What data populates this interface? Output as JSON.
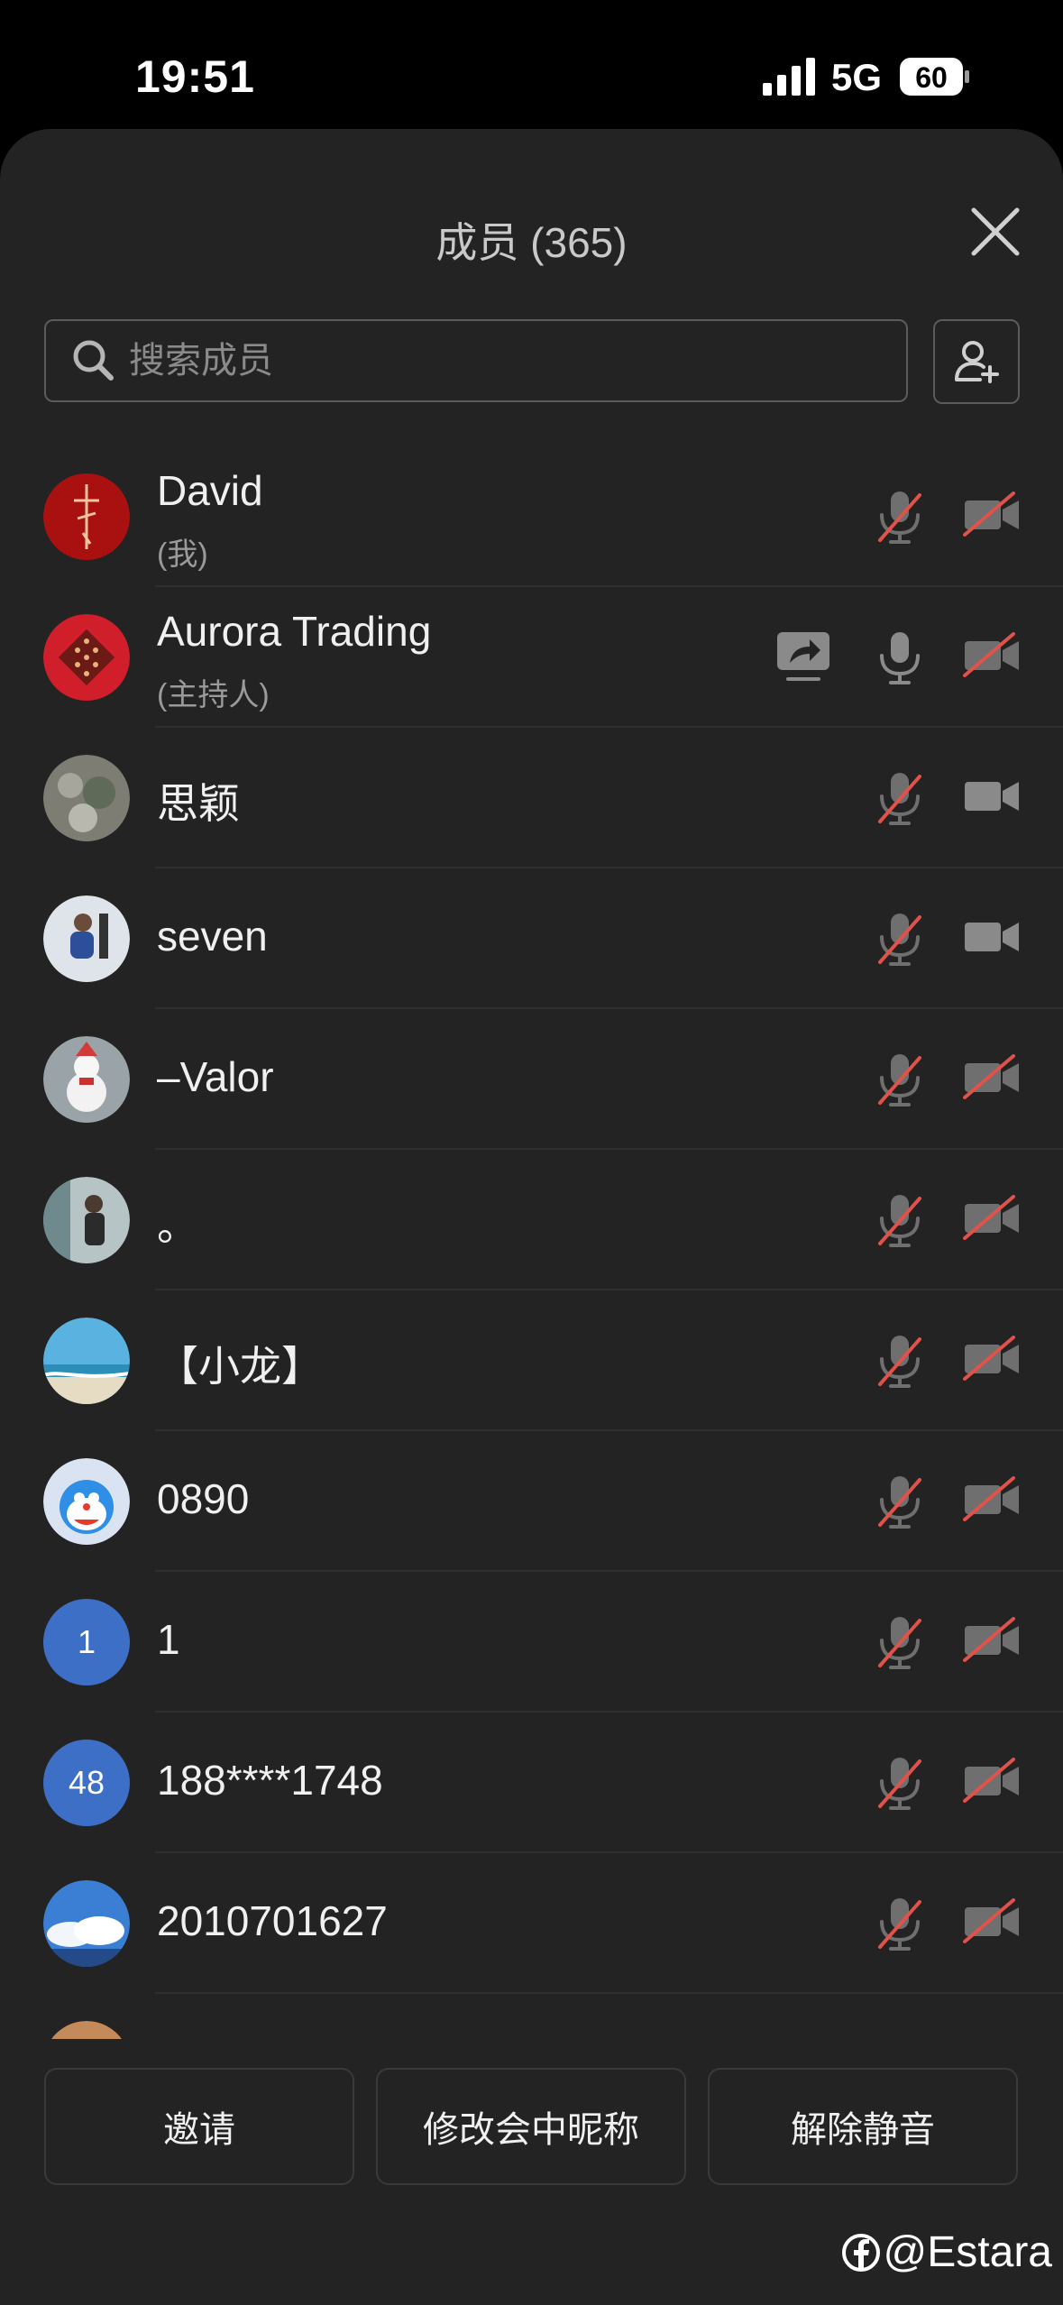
{
  "status_bar": {
    "time": "19:51",
    "network": "5G",
    "battery": "60"
  },
  "sheet": {
    "title": "成员 (365)"
  },
  "search": {
    "placeholder": "搜索成员"
  },
  "members": [
    {
      "name": "David",
      "role": "(我)",
      "mic": "muted",
      "camera": "off",
      "sharing": false
    },
    {
      "name": "Aurora Trading",
      "role": "(主持人)",
      "mic": "on",
      "camera": "off",
      "sharing": true
    },
    {
      "name": "思颖",
      "role": "",
      "mic": "muted",
      "camera": "on",
      "sharing": false
    },
    {
      "name": "seven",
      "role": "",
      "mic": "muted",
      "camera": "on",
      "sharing": false
    },
    {
      "name": "–Valor",
      "role": "",
      "mic": "muted",
      "camera": "off",
      "sharing": false
    },
    {
      "name": "。",
      "role": "",
      "mic": "muted",
      "camera": "off",
      "sharing": false
    },
    {
      "name": "【小龙】",
      "role": "",
      "mic": "muted",
      "camera": "off",
      "sharing": false
    },
    {
      "name": "0890",
      "role": "",
      "mic": "muted",
      "camera": "off",
      "sharing": false
    },
    {
      "name": "1",
      "role": "",
      "avatar_text": "1",
      "mic": "muted",
      "camera": "off",
      "sharing": false
    },
    {
      "name": "188****1748",
      "role": "",
      "avatar_text": "48",
      "mic": "muted",
      "camera": "off",
      "sharing": false
    },
    {
      "name": "2010701627",
      "role": "",
      "mic": "muted",
      "camera": "off",
      "sharing": false
    }
  ],
  "bottom_bar": {
    "invite": "邀请",
    "rename": "修改会中昵称",
    "unmute": "解除静音"
  },
  "watermark": "@Estara",
  "colors": {
    "background": "#232323",
    "muted_slash": "#e0524a",
    "accent_avatar": "#3d6fc6"
  }
}
